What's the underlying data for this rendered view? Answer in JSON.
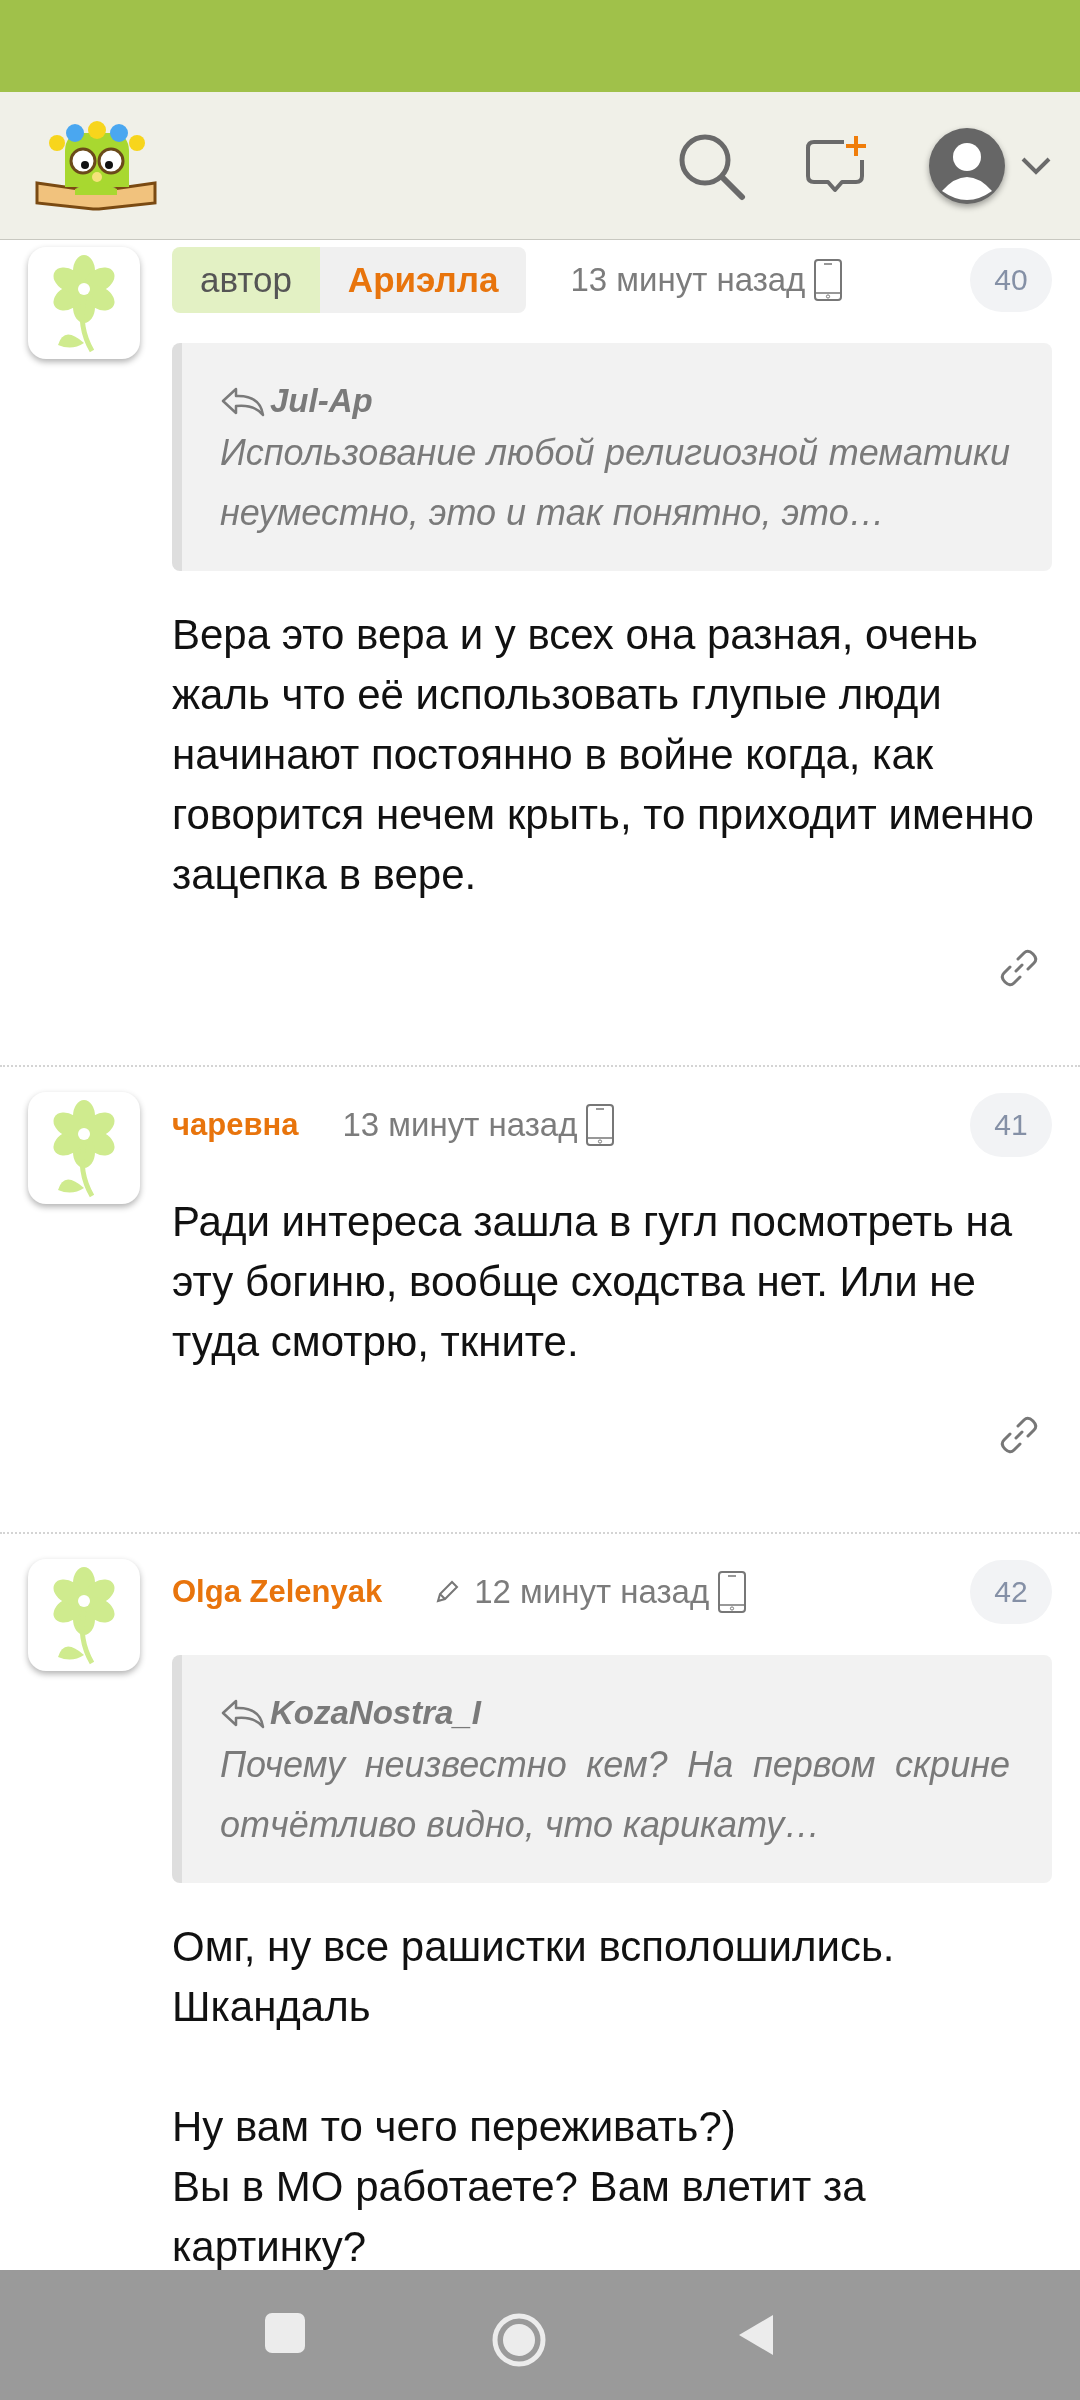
{
  "comments": [
    {
      "kind": "author",
      "author_badge": "автор",
      "name": "Ариэлла",
      "edited": false,
      "time": "13 минут назад",
      "number": "40",
      "quote": {
        "author": "Jul-Ap",
        "text": "Использование любой религиозной тематики неуместно, это и так понятно, это…"
      },
      "text": "Вера это вера и у всех она разная, очень жаль что её использовать глупые люди начинают постоянно в войне когда, как говорится нечем крыть, то приходит именно зацепка в вере.",
      "has_link": true
    },
    {
      "kind": "user",
      "name": "чаревна",
      "edited": false,
      "time": "13 минут назад",
      "number": "41",
      "text": "Ради интереса зашла в гугл посмотреть на эту богиню, вообще сходства нет. Или не туда смотрю, ткните.",
      "has_link": true
    },
    {
      "kind": "user",
      "name": "Olga Zelenyak",
      "edited": true,
      "time": "12 минут назад",
      "number": "42",
      "quote": {
        "author": "KozaNostra_I",
        "text": "Почему неизвестно кем? На первом скрине отчётливо видно, что карикату…"
      },
      "text": "Омг, ну все рашистки всполошились.\nШкандаль\n\nНу вам то чего переживать?)\nВы в МО работаете? Вам влетит за картинку?",
      "has_link": false
    }
  ]
}
